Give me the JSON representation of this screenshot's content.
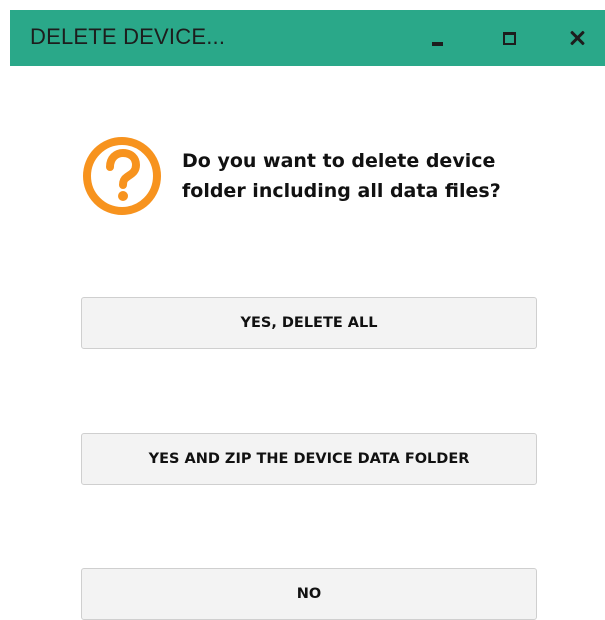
{
  "window": {
    "title": "DELETE DEVICE...",
    "titlebar_color": "#2aa889",
    "controls": {
      "minimize_icon": "minimize-icon",
      "maximize_icon": "maximize-icon",
      "close_icon": "close-icon"
    }
  },
  "dialog": {
    "icon": "question-icon",
    "icon_color": "#f7931e",
    "message_line1": "Do you want to delete device",
    "message_line2": "folder including all data files?"
  },
  "buttons": {
    "delete_all": "YES, DELETE ALL",
    "zip_folder": "YES AND ZIP THE DEVICE DATA FOLDER",
    "no": "NO"
  }
}
